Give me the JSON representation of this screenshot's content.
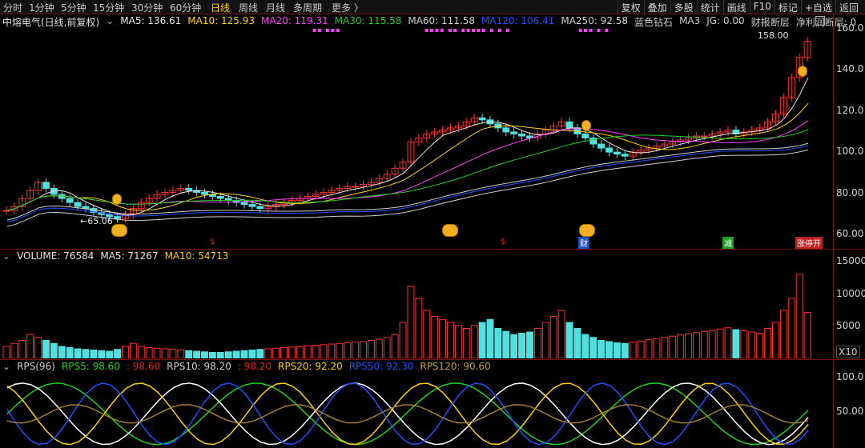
{
  "toolbar": {
    "periods": [
      "分时",
      "1分钟",
      "5分钟",
      "15分钟",
      "30分钟",
      "60分钟",
      "日线",
      "周线",
      "月线",
      "多周期",
      "更多"
    ],
    "active_period": "日线",
    "right_buttons": [
      "复权",
      "叠加",
      "多股",
      "统计",
      "画线",
      "F10",
      "标记",
      "+自选",
      "返回"
    ]
  },
  "price_panel": {
    "title": "中熔电气(日线,前复权)",
    "ma": [
      {
        "label": "MA5: 136.61",
        "color": "#e6e6e6"
      },
      {
        "label": "MA10: 125.93",
        "color": "#ffd200"
      },
      {
        "label": "MA20: 119.31",
        "color": "#ff40ff"
      },
      {
        "label": "MA30: 115.58",
        "color": "#20d020"
      },
      {
        "label": "MA60: 111.58",
        "color": "#d0d0d0"
      },
      {
        "label": "MA120: 106.41",
        "color": "#2050ff"
      },
      {
        "label": "MA250: 92.58",
        "color": "#d0d0d0"
      },
      {
        "label": "蓝色钻石",
        "color": "#d0d0d0"
      },
      {
        "label": "MA3",
        "color": "#d0d0d0"
      },
      {
        "label": "JG: 0.00",
        "color": "#d0d0d0"
      },
      {
        "label": "财报断层",
        "color": "#d0d0d0"
      },
      {
        "label": "净利润断层: 0",
        "color": "#d0d0d0"
      }
    ],
    "y_ticks": [
      "160.0",
      "140.0",
      "120.0",
      "100.0",
      "80.00",
      "60.00"
    ],
    "annotations": {
      "high": "158.00",
      "low": "65.06"
    },
    "badges": [
      {
        "text": "$",
        "color": "#e02020"
      },
      {
        "text": "$",
        "color": "#e02020"
      },
      {
        "text": "财",
        "color": "#4080ff"
      },
      {
        "text": "减",
        "color": "#20c020"
      },
      {
        "text": "涨停开",
        "color": "#ffffff"
      }
    ]
  },
  "volume_panel": {
    "items": [
      {
        "label": "VOLUME: 76584",
        "color": "#e6e6e6"
      },
      {
        "label": "MA5: 71267",
        "color": "#e6e6e6"
      },
      {
        "label": "MA10: 54713",
        "color": "#ffd200"
      }
    ],
    "y_ticks": [
      "15000",
      "10000",
      "5000"
    ],
    "unit": "X10"
  },
  "rps_panel": {
    "items": [
      {
        "label": "RPS(96)",
        "color": "#d0d0d0"
      },
      {
        "label": "RPS5: 98.60",
        "color": "#20d020"
      },
      {
        "label": ": 98.60",
        "color": "#e02020"
      },
      {
        "label": "RPS10: 98.20",
        "color": "#d0d0d0"
      },
      {
        "label": ": 98.20",
        "color": "#e02020"
      },
      {
        "label": "RPS20: 92.20",
        "color": "#ffd200"
      },
      {
        "label": "RPS50: 92.30",
        "color": "#2050ff"
      },
      {
        "label": "RPS120: 90.60",
        "color": "#c0a040"
      }
    ],
    "y_ticks": [
      "100.0",
      "50.00"
    ]
  },
  "chart_data": {
    "type": "candlestick",
    "y_range": [
      55,
      165
    ],
    "candles": [],
    "closes": [
      74,
      76,
      80,
      84,
      88,
      85,
      82,
      80,
      78,
      76,
      75,
      73,
      72,
      71,
      70,
      72,
      75,
      78,
      80,
      82,
      83,
      84,
      85,
      84,
      83,
      82,
      81,
      80,
      79,
      78,
      77,
      76,
      75,
      76,
      77,
      78,
      79,
      80,
      81,
      82,
      83,
      84,
      85,
      86,
      86,
      87,
      88,
      90,
      92,
      95,
      98,
      108,
      110,
      112,
      113,
      114,
      115,
      116,
      118,
      120,
      119,
      117,
      115,
      113,
      112,
      111,
      110,
      112,
      114,
      116,
      118,
      115,
      112,
      110,
      107,
      105,
      103,
      102,
      101,
      103,
      104,
      105,
      106,
      107,
      108,
      109,
      110,
      111,
      111,
      112,
      113,
      114,
      112,
      113,
      114,
      115,
      118,
      122,
      130,
      140,
      150,
      158
    ],
    "ma_series": [
      {
        "name": "MA5",
        "color": "#e6e6e6"
      },
      {
        "name": "MA10",
        "color": "#ffd200"
      },
      {
        "name": "MA20",
        "color": "#ff40ff"
      },
      {
        "name": "MA30",
        "color": "#20d020"
      },
      {
        "name": "MA60",
        "color": "#d0d0d0"
      },
      {
        "name": "MA120",
        "color": "#2050ff"
      },
      {
        "name": "MA250",
        "color": "#d0d0d0"
      }
    ],
    "volume": [
      2000,
      2500,
      3000,
      4000,
      3500,
      3000,
      2500,
      2000,
      1800,
      1600,
      1500,
      1400,
      1300,
      1200,
      1500,
      2000,
      2500,
      2000,
      1800,
      1700,
      1600,
      1500,
      1400,
      1300,
      1200,
      1100,
      1000,
      1000,
      1100,
      1200,
      1300,
      1400,
      1500,
      1600,
      1700,
      1800,
      1900,
      2000,
      2100,
      2200,
      2300,
      2400,
      2500,
      2600,
      2700,
      2800,
      3000,
      3200,
      3500,
      4000,
      6000,
      12000,
      10000,
      8000,
      7000,
      6500,
      6000,
      5500,
      5000,
      5500,
      6000,
      6500,
      5000,
      4500,
      4000,
      4200,
      4400,
      5000,
      6000,
      7000,
      8000,
      6000,
      5000,
      4000,
      3500,
      3000,
      2800,
      2600,
      2500,
      2700,
      2900,
      3100,
      3300,
      3500,
      3700,
      3900,
      4100,
      4300,
      4500,
      4700,
      4900,
      5100,
      4800,
      4600,
      4400,
      4200,
      5000,
      6000,
      8000,
      10000,
      14000,
      7658
    ]
  }
}
